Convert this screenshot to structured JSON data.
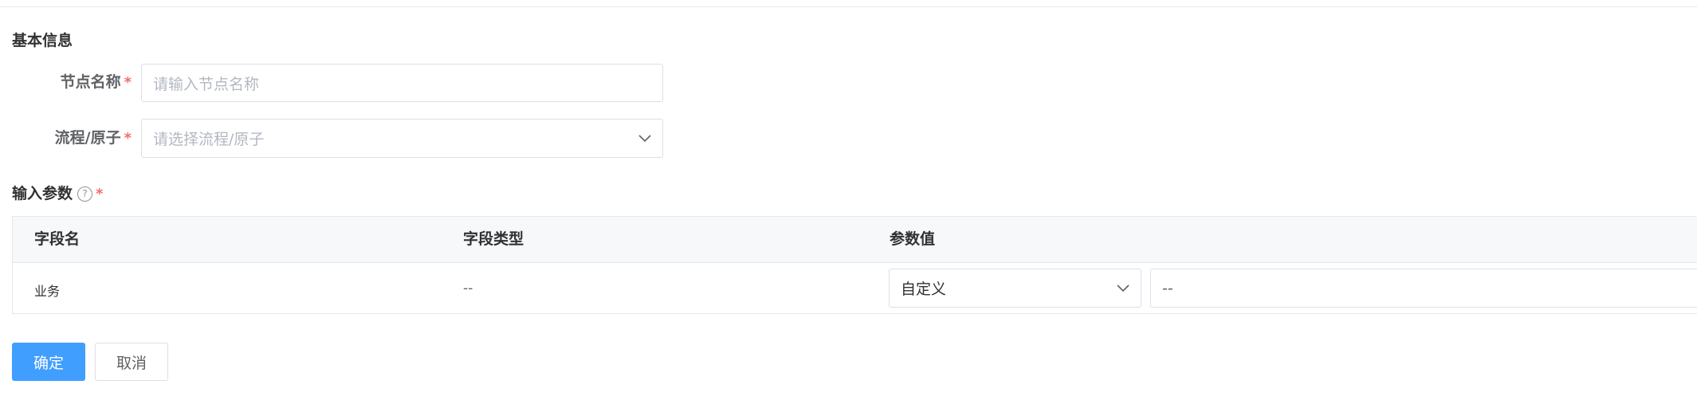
{
  "basic_info": {
    "title": "基本信息"
  },
  "node_name": {
    "label": "节点名称",
    "required_mark": "*",
    "placeholder": "请输入节点名称"
  },
  "flow_atom": {
    "label": "流程/原子",
    "required_mark": "*",
    "placeholder": "请选择流程/原子"
  },
  "input_params": {
    "title": "输入参数",
    "help_icon": "?",
    "required_mark": "*",
    "columns": [
      "字段名",
      "字段类型",
      "参数值"
    ],
    "rows": [
      {
        "field_name": "业务",
        "field_type": "--",
        "value_mode": "自定义",
        "value": "--"
      }
    ]
  },
  "actions": {
    "confirm_label": "确定",
    "cancel_label": "取消"
  },
  "colors": {
    "primary": "#409eff",
    "required": "#f56c6c",
    "border": "#dcdfe6",
    "header_bg": "#f7f8fa"
  }
}
